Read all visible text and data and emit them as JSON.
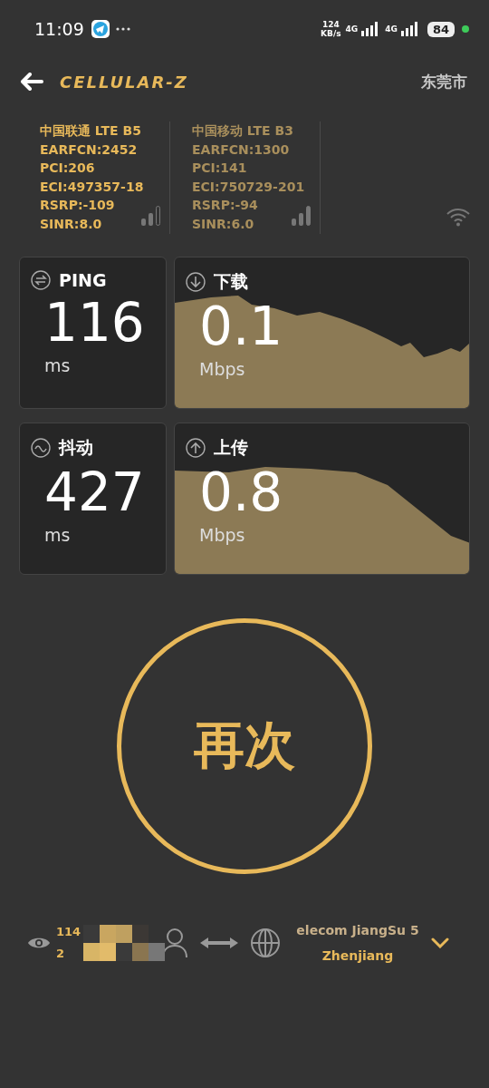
{
  "status_bar": {
    "time": "11:09",
    "net_speed": "124",
    "net_unit": "KB/s",
    "sim1": "4G",
    "sim2": "4G",
    "battery": "84"
  },
  "header": {
    "logo": "CELLULAR-Z",
    "city": "东莞市"
  },
  "cells": [
    {
      "title": "中国联通 LTE B5",
      "lines": [
        "EARFCN:2452",
        "PCI:206",
        "ECI:497357-18",
        "RSRP:-109",
        "SINR:8.0"
      ],
      "selected": true
    },
    {
      "title": "中国移动 LTE B3",
      "lines": [
        "EARFCN:1300",
        "PCI:141",
        "ECI:750729-201",
        "RSRP:-94",
        "SINR:6.0"
      ],
      "selected": false
    }
  ],
  "metrics": [
    {
      "kind": "ping",
      "label": "PING",
      "value": "116",
      "unit": "ms"
    },
    {
      "kind": "download",
      "label": "下载",
      "value": "0.1",
      "unit": "Mbps"
    },
    {
      "kind": "jitter",
      "label": "抖动",
      "value": "427",
      "unit": "ms"
    },
    {
      "kind": "upload",
      "label": "上传",
      "value": "0.8",
      "unit": "Mbps"
    }
  ],
  "retest_button": "再次",
  "server": {
    "ip_line_1": "114",
    "ip_line_2": "2",
    "provider": "elecom JiangSu 5",
    "city": "Zhenjiang"
  }
}
